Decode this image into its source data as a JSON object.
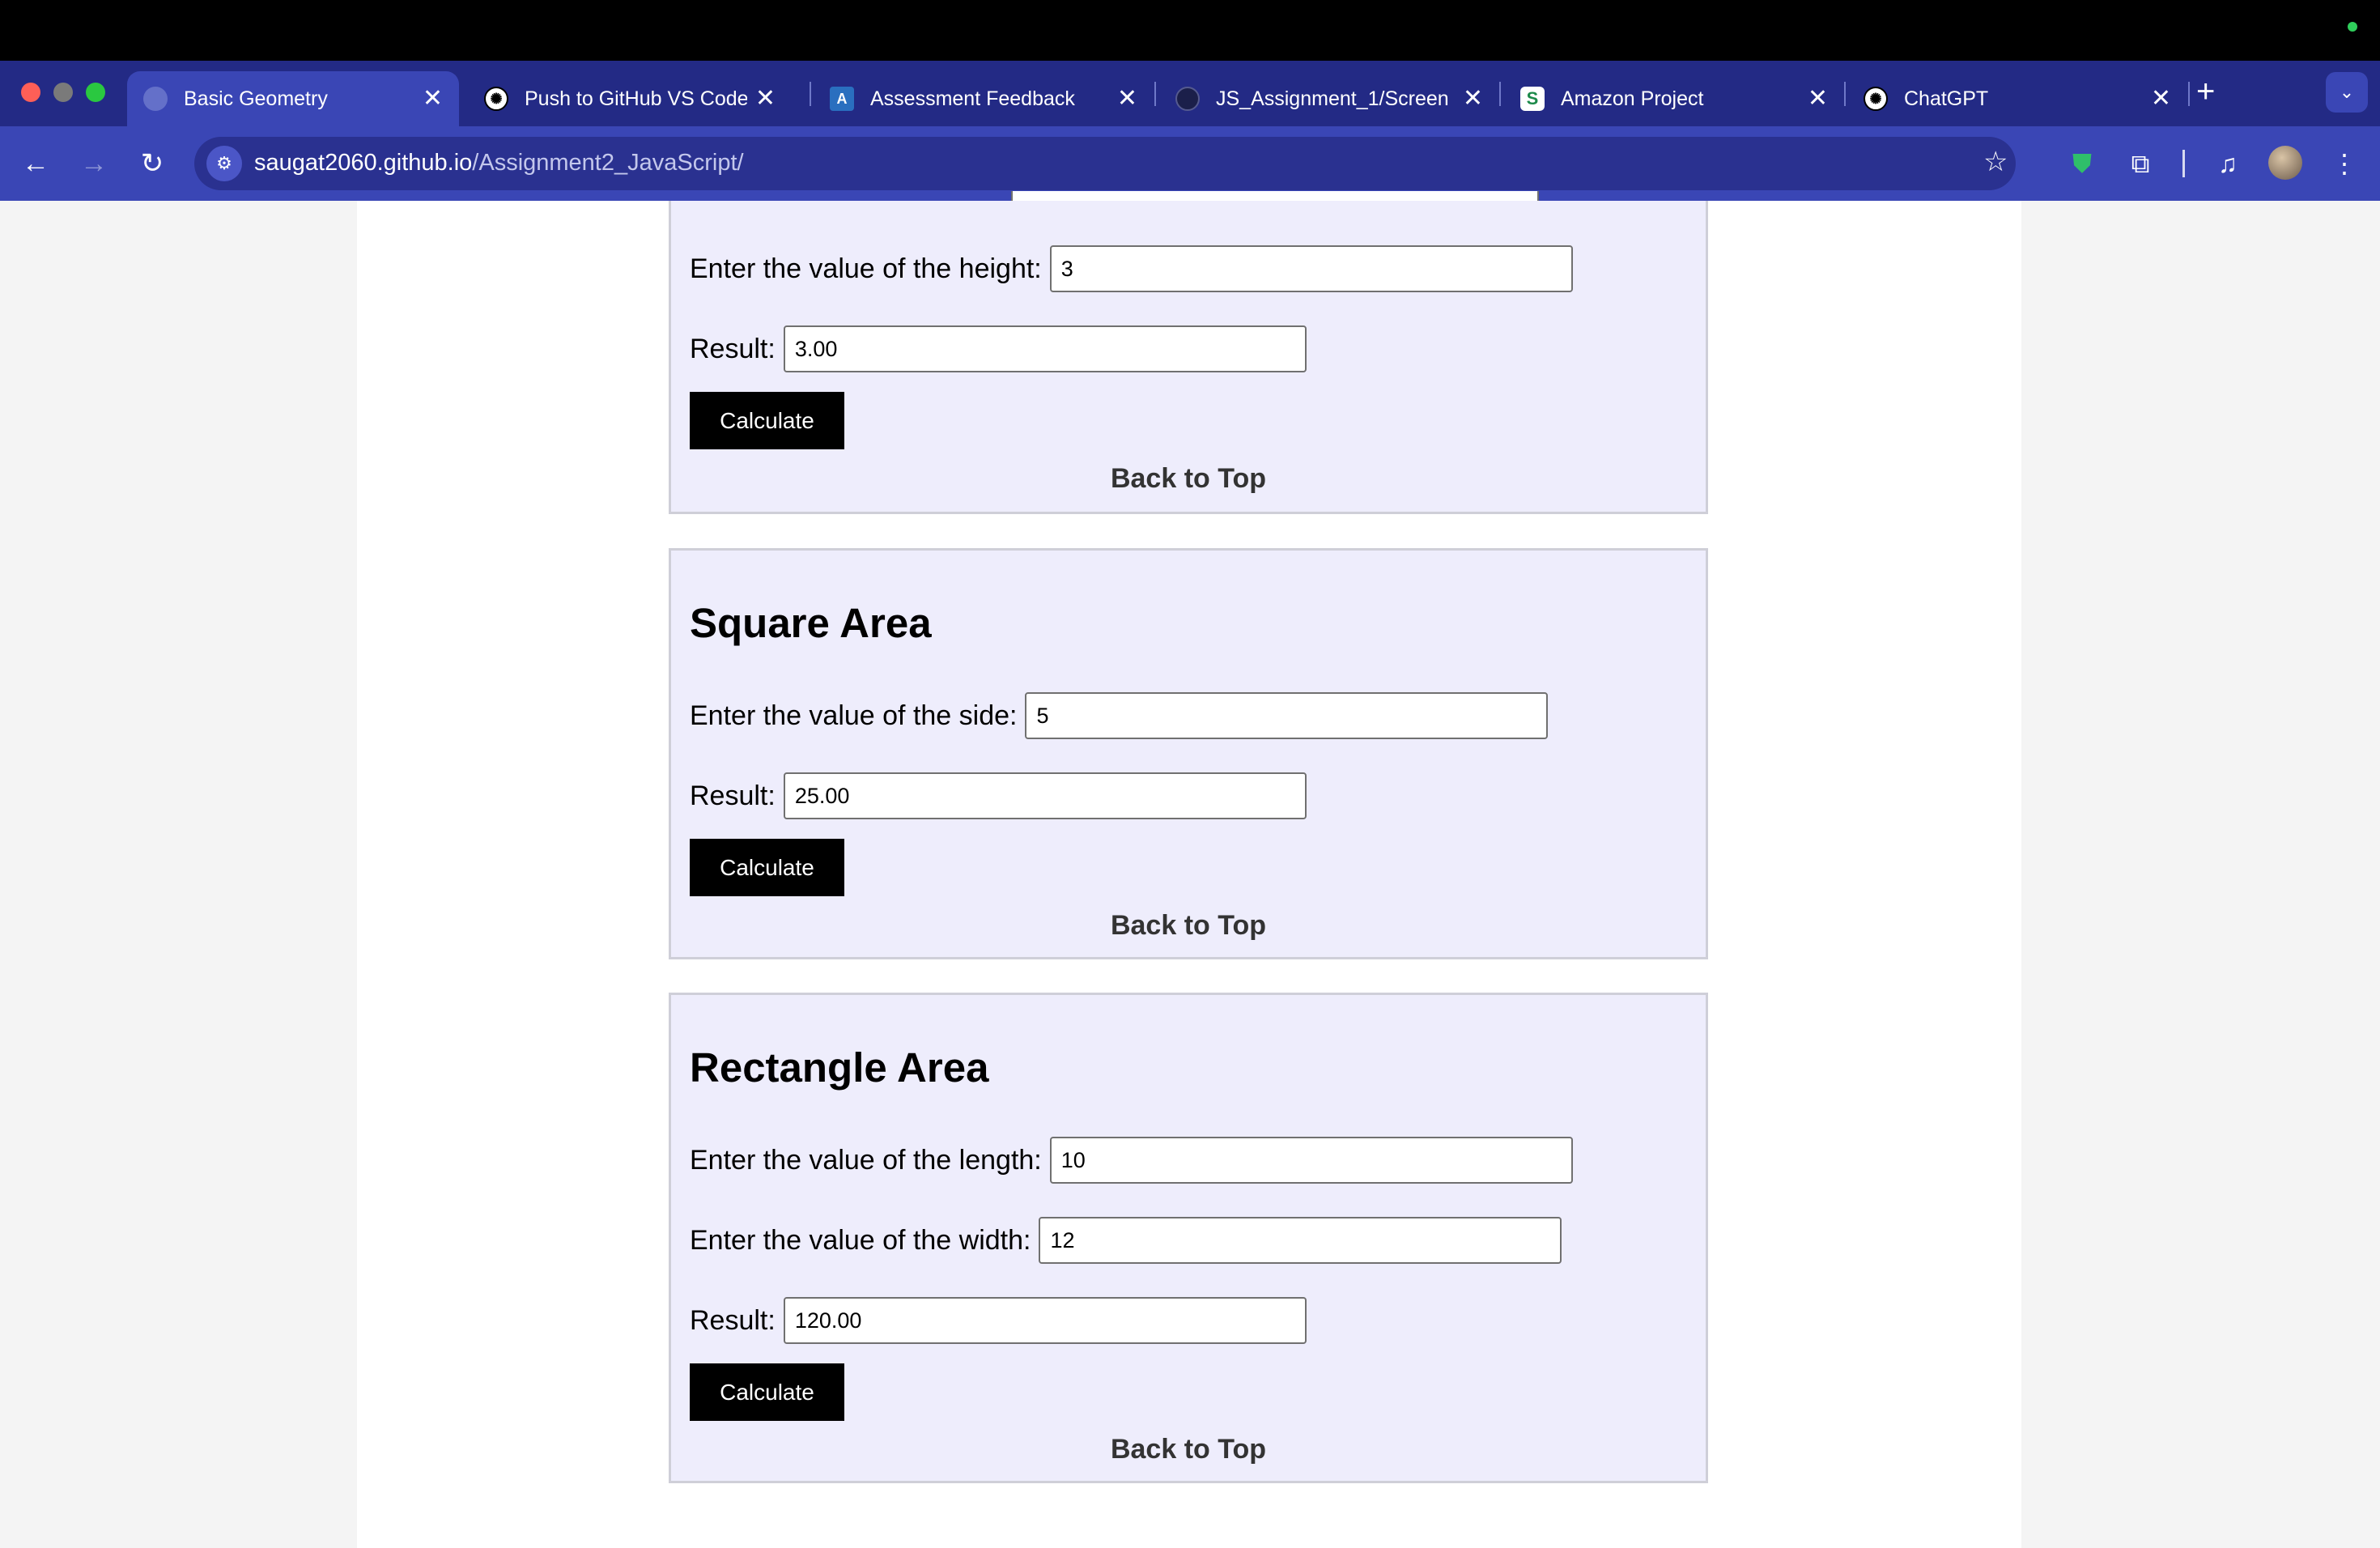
{
  "browser": {
    "tabs": [
      {
        "label": "Basic Geometry",
        "close": "✕"
      },
      {
        "label": "Push to GitHub VS Code",
        "close": "✕"
      },
      {
        "label": "Assessment Feedback",
        "close": "✕"
      },
      {
        "label": "JS_Assignment_1/Screen",
        "close": "✕"
      },
      {
        "label": "Amazon Project",
        "close": "✕"
      },
      {
        "label": "ChatGPT",
        "close": "✕"
      }
    ],
    "new_tab": "+",
    "tab_search": "⌄",
    "url_host": "saugat2060.github.io",
    "url_path": "/Assignment2_JavaScript/",
    "icons": {
      "back": "←",
      "forward": "→",
      "reload": "↻",
      "site_info": "⚙",
      "star": "☆",
      "shield": "⛊",
      "extensions": "⧉",
      "media": "♫",
      "menu": "⋮"
    },
    "colors": {
      "tab_strip": "#232a85",
      "toolbar": "#3a46b5"
    }
  },
  "page": {
    "triangle": {
      "height_label": "Enter the value of the height:",
      "height_value": "3",
      "result_label": "Result:",
      "result_value": "3.00",
      "calculate": "Calculate",
      "back_to_top": "Back to Top"
    },
    "square": {
      "title": "Square Area",
      "side_label": "Enter the value of the side:",
      "side_value": "5",
      "result_label": "Result:",
      "result_value": "25.00",
      "calculate": "Calculate",
      "back_to_top": "Back to Top"
    },
    "rectangle": {
      "title": "Rectangle Area",
      "length_label": "Enter the value of the length:",
      "length_value": "10",
      "width_label": "Enter the value of the width:",
      "width_value": "12",
      "result_label": "Result:",
      "result_value": "120.00",
      "calculate": "Calculate",
      "back_to_top": "Back to Top"
    },
    "colors": {
      "section_bg": "#eeedfc",
      "button_bg": "#000000"
    }
  }
}
